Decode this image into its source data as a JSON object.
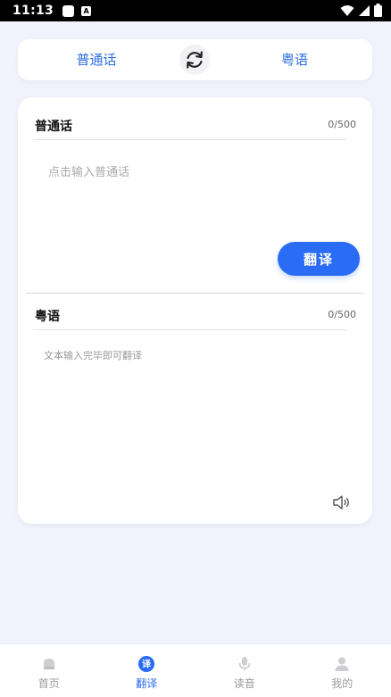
{
  "status_bar": {
    "time": "11:13",
    "notif_letter": "A"
  },
  "lang_bar": {
    "source_lang": "普通话",
    "target_lang": "粤语"
  },
  "input_section": {
    "title": "普通话",
    "count": "0/500",
    "placeholder": "点击输入普通话"
  },
  "translate_button": {
    "label": "翻译"
  },
  "output_section": {
    "title": "粤语",
    "count": "0/500",
    "placeholder": "文本输入完毕即可翻译"
  },
  "nav": {
    "items": [
      {
        "label": "首页",
        "icon": "home-icon",
        "active": false
      },
      {
        "label": "翻译",
        "icon": "translate-icon",
        "icon_char": "译",
        "active": true
      },
      {
        "label": "读音",
        "icon": "microphone-icon",
        "active": false
      },
      {
        "label": "我的",
        "icon": "profile-icon",
        "active": false
      }
    ]
  },
  "colors": {
    "accent": "#2a6cf6",
    "link": "#2d6ee0",
    "background": "#f1f2fb"
  }
}
